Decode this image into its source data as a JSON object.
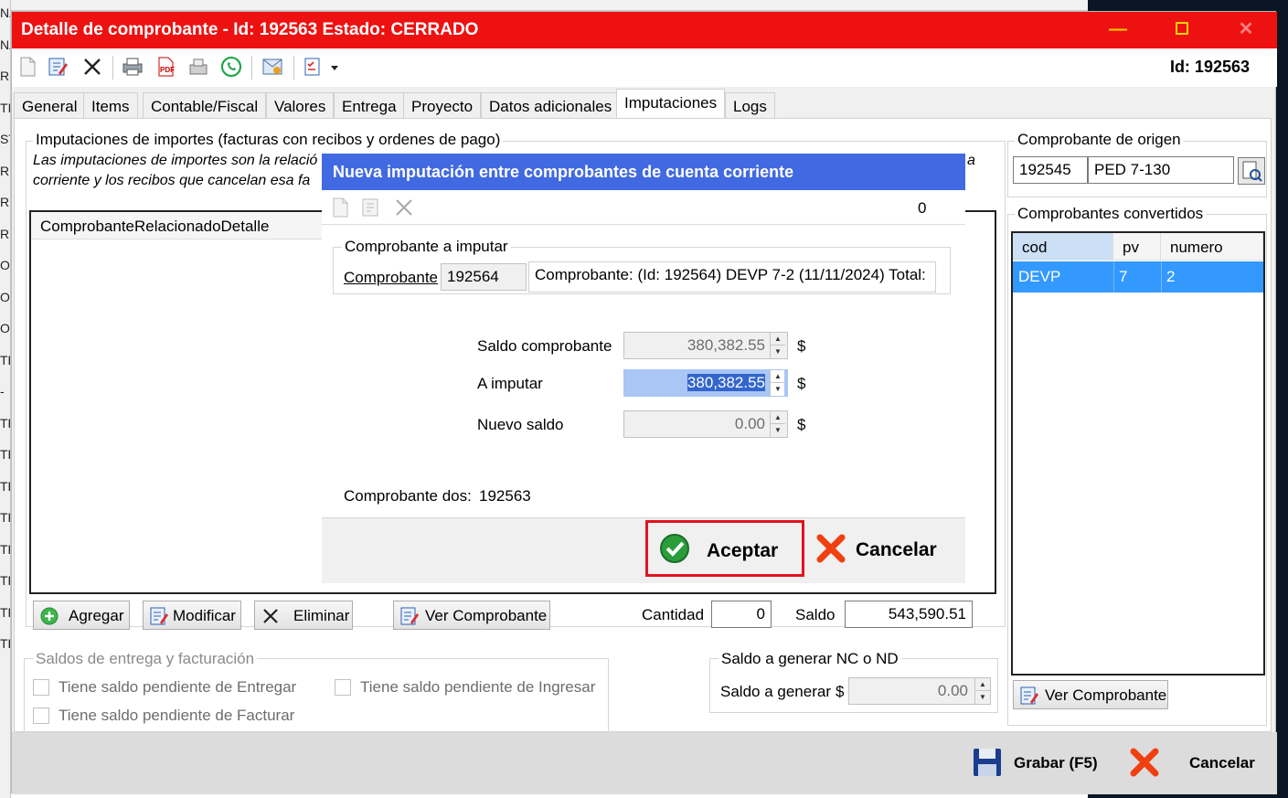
{
  "background": {
    "left_edge_fragments": [
      "NA",
      "NA",
      "RC",
      "TIC",
      "ST",
      "RI",
      "RI",
      "RI",
      "OC",
      "OC",
      "OC",
      "TF",
      "-",
      "TF",
      "TF",
      "TF",
      "TF",
      "TF",
      "TF",
      "TF",
      "TF"
    ]
  },
  "window": {
    "title": "Detalle de comprobante - Id: 192563 Estado: CERRADO",
    "title_bar_color": "#ee1111",
    "id_label": "Id: 192563"
  },
  "toolbar": {
    "icons": [
      "new-document-icon",
      "edit-document-icon",
      "delete-icon",
      "print-icon",
      "pdf-icon",
      "fax-icon",
      "whatsapp-icon",
      "email-icon",
      "checklist-icon",
      "dropdown-arrow-icon"
    ]
  },
  "tabs": [
    {
      "label": "General"
    },
    {
      "label": "Items"
    },
    {
      "label": "Contable/Fiscal"
    },
    {
      "label": "Valores"
    },
    {
      "label": "Entrega"
    },
    {
      "label": "Proyecto"
    },
    {
      "label": "Datos adicionales"
    },
    {
      "label": "Imputaciones",
      "active": true
    },
    {
      "label": "Logs"
    }
  ],
  "imputaciones": {
    "group_title": "Imputaciones de importes (facturas con recibos y ordenes de pago)",
    "description_line1": "Las imputaciones de importes son la relació",
    "description_line2": "corriente y los recibos que cancelan esa fa",
    "description_tail": "a",
    "grid_column": "ComprobanteRelacionadoDetalle",
    "buttons": {
      "agregar": "Agregar",
      "modificar": "Modificar",
      "eliminar": "Eliminar",
      "ver_comprobante": "Ver Comprobante"
    },
    "cantidad_label": "Cantidad",
    "cantidad_value": "0",
    "saldo_label": "Saldo",
    "saldo_value": "543,590.51"
  },
  "saldos": {
    "group_title": "Saldos de entrega y facturación",
    "entregar": "Tiene saldo pendiente de Entregar",
    "ingresar": "Tiene saldo pendiente de Ingresar",
    "facturar": "Tiene saldo pendiente de Facturar"
  },
  "saldo_generar": {
    "group_title": "Saldo a generar NC o ND",
    "label": "Saldo a generar",
    "currency": "$",
    "value": "0.00"
  },
  "origen": {
    "group_title": "Comprobante de origen",
    "id": "192545",
    "code": "PED 7-130"
  },
  "convertidos": {
    "group_title": "Comprobantes convertidos",
    "columns": [
      "cod",
      "pv",
      "numero"
    ],
    "rows": [
      {
        "cod": "DEVP",
        "pv": "7",
        "numero": "2"
      }
    ],
    "selected_color": "#3399ff",
    "ver_button": "Ver Comprobante"
  },
  "footer": {
    "grabar": "Grabar (F5)",
    "cancelar": "Cancelar"
  },
  "dialog": {
    "title": "Nueva imputación entre comprobantes de cuenta corriente",
    "title_color": "#4169e1",
    "toolbar_count": "0",
    "group_title": "Comprobante a imputar",
    "comprobante_link": "Comprobante",
    "comprobante_id": "192564",
    "comprobante_desc": "Comprobante: (Id: 192564) DEVP 7-2 (11/11/2024) Total:",
    "saldo_label": "Saldo comprobante",
    "saldo_value": "380,382.55",
    "imputar_label": "A imputar",
    "imputar_value": "380,382.55",
    "nuevo_label": "Nuevo saldo",
    "nuevo_value": "0.00",
    "currency": "$",
    "comp_dos_label": "Comprobante dos:",
    "comp_dos_value": "192563",
    "aceptar": "Aceptar",
    "cancelar": "Cancelar",
    "highlight_color": "#e3121f"
  }
}
